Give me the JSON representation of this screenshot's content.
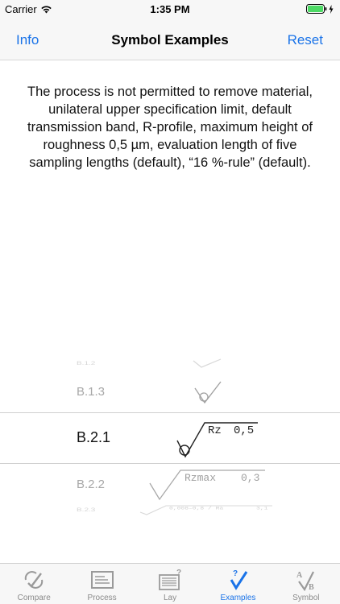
{
  "status_bar": {
    "carrier": "Carrier",
    "time": "1:35 PM"
  },
  "nav": {
    "left_button": "Info",
    "title": "Symbol Examples",
    "right_button": "Reset"
  },
  "description": "The process is not permitted to remove material, unilateral upper specification limit, default transmission band, R-profile, maximum height of roughness 0,5 µm, evaluation length of five sampling lengths (default), “16 %-rule” (default).",
  "picker": {
    "items": [
      {
        "code": "B.1.2",
        "symbol_text": "",
        "value": ""
      },
      {
        "code": "B.1.3",
        "symbol_text": "",
        "value": ""
      },
      {
        "code": "B.2.1",
        "symbol_text": "Rz",
        "value": "0,5"
      },
      {
        "code": "B.2.2",
        "symbol_text": "Rzmax",
        "value": "0,3"
      },
      {
        "code": "B.2.3",
        "symbol_text": "0,008–0,8 / Ra",
        "value": "3,1"
      }
    ],
    "selected_index": 2
  },
  "tabs": [
    {
      "label": "Compare",
      "icon": "compare-icon",
      "active": false
    },
    {
      "label": "Process",
      "icon": "process-icon",
      "active": false
    },
    {
      "label": "Lay",
      "icon": "lay-icon",
      "active": false
    },
    {
      "label": "Examples",
      "icon": "examples-icon",
      "active": true
    },
    {
      "label": "Symbol",
      "icon": "symbol-icon",
      "active": false
    }
  ],
  "colors": {
    "accent": "#1a73e8",
    "inactive": "#8a8a8a"
  }
}
